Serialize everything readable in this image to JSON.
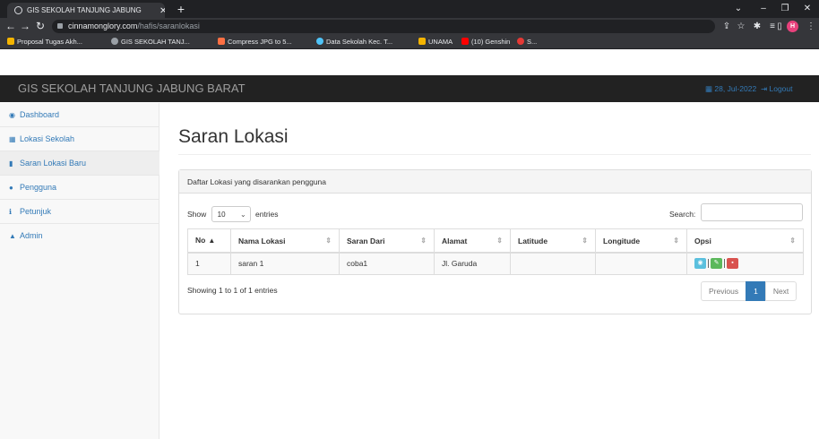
{
  "browser": {
    "tab_title": "GIS SEKOLAH TANJUNG JABUNG",
    "url_host": "cinnamonglory.com",
    "url_path": "/hafis/saranlokasi",
    "profile_initial": "H",
    "bookmarks": [
      {
        "label": "Proposal Tugas Akh...",
        "color": "#f4b400"
      },
      {
        "label": "GIS SEKOLAH TANJ...",
        "color": "#9aa0a6"
      },
      {
        "label": "Compress JPG to 5...",
        "color": "#ff7043"
      },
      {
        "label": "Data Sekolah Kec. T...",
        "color": "#4fc3f7"
      },
      {
        "label": "UNAMA",
        "color": "#f4b400"
      },
      {
        "label": "(10) Genshin",
        "color": "#ff0000"
      },
      {
        "label": "S...",
        "color": "#e53935"
      }
    ]
  },
  "app": {
    "brand": "GIS SEKOLAH TANJUNG JABUNG BARAT",
    "date": "28, Jul-2022",
    "logout": "Logout"
  },
  "sidebar": {
    "items": [
      {
        "label": "Dashboard",
        "icon": "dashboard-icon",
        "glyph": "◉"
      },
      {
        "label": "Lokasi Sekolah",
        "icon": "table-icon",
        "glyph": "▦"
      },
      {
        "label": "Saran Lokasi Baru",
        "icon": "book-icon",
        "glyph": "▮"
      },
      {
        "label": "Pengguna",
        "icon": "users-icon",
        "glyph": "●"
      },
      {
        "label": "Petunjuk",
        "icon": "info-icon",
        "glyph": "ℹ"
      },
      {
        "label": "Admin",
        "icon": "user-icon",
        "glyph": "▲"
      }
    ]
  },
  "main": {
    "title": "Saran Lokasi",
    "panel_heading": "Daftar Lokasi yang disarankan pengguna",
    "show_label": "Show",
    "entries_label": "entries",
    "page_length": "10",
    "search_label": "Search:",
    "search_value": "",
    "columns": [
      "No",
      "Nama Lokasi",
      "Saran Dari",
      "Alamat",
      "Latitude",
      "Longitude",
      "Opsi"
    ],
    "rows": [
      {
        "no": "1",
        "nama": "saran 1",
        "dari": "coba1",
        "alamat": "Jl. Garuda",
        "lat": "",
        "lng": ""
      }
    ],
    "info": "Showing 1 to 1 of 1 entries",
    "pagination": {
      "previous": "Previous",
      "current": "1",
      "next": "Next"
    }
  },
  "colors": {
    "accent": "#337ab7",
    "navbar": "#222222",
    "btn_view": "#5bc0de",
    "btn_edit": "#5cb85c",
    "btn_delete": "#d9534f"
  }
}
